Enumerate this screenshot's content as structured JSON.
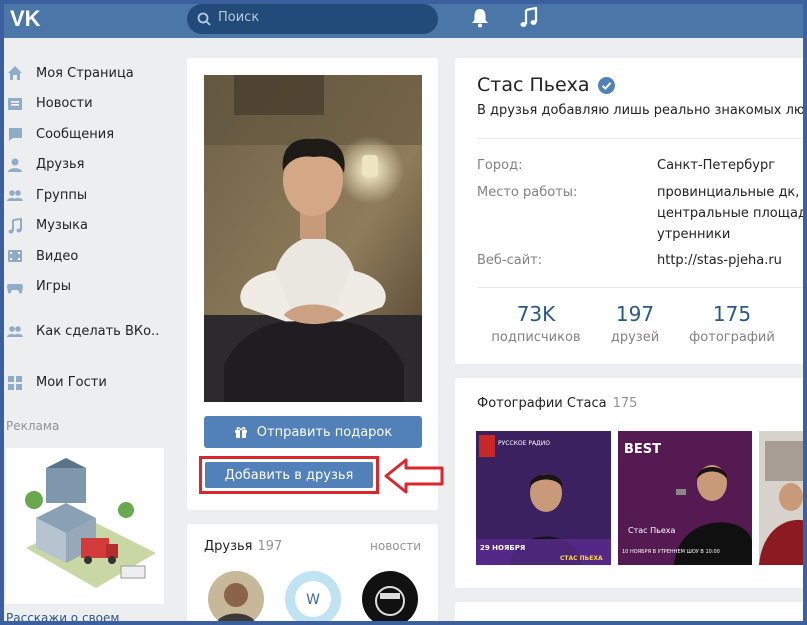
{
  "colors": {
    "header": "#4a76a8",
    "accent": "#5181b8",
    "link": "#2a5885",
    "annotation": "#d9262f"
  },
  "header": {
    "logo": "vk-logo",
    "search_placeholder": "Поиск",
    "icons": [
      "bell-icon",
      "music-icon"
    ]
  },
  "menu": {
    "items": [
      {
        "label": "Моя Страница",
        "icon": "home-icon"
      },
      {
        "label": "Новости",
        "icon": "news-icon"
      },
      {
        "label": "Сообщения",
        "icon": "messages-icon"
      },
      {
        "label": "Друзья",
        "icon": "friends-icon"
      },
      {
        "label": "Группы",
        "icon": "groups-icon"
      },
      {
        "label": "Музыка",
        "icon": "music-icon"
      },
      {
        "label": "Видео",
        "icon": "video-icon"
      },
      {
        "label": "Игры",
        "icon": "games-icon"
      }
    ],
    "extra": [
      {
        "label": "Как сделать ВКо..",
        "icon": "app-icon"
      },
      {
        "label": "Мои Гости",
        "icon": "app-icon"
      }
    ],
    "ad_label": "Реклама",
    "ad_text": "Расскажи о своем"
  },
  "avatar": {
    "gift_button": "Отправить подарок",
    "add_friend_button": "Добавить в друзья"
  },
  "friends": {
    "title": "Друзья",
    "count": "197",
    "news_link": "новости"
  },
  "profile": {
    "name": "Стас Пьеха",
    "status": "В друзья добавляю лишь реально знакомых люд",
    "info": [
      {
        "label": "Город:",
        "value": [
          "Санкт-Петербург"
        ]
      },
      {
        "label": "Место работы:",
        "value": [
          "провинциальные дк, м",
          "центральные площади",
          "утренники"
        ]
      },
      {
        "label": "Веб-сайт:",
        "value": [
          "http://stas-pjeha.ru"
        ]
      }
    ],
    "counters": [
      {
        "num": "73K",
        "label": "подписчиков"
      },
      {
        "num": "197",
        "label": "друзей"
      },
      {
        "num": "175",
        "label": "фотографий"
      }
    ]
  },
  "photos": {
    "title": "Фотографии Стаса",
    "count": "175",
    "poster1": {
      "radio": "РУССКОЕ РАДИО",
      "date": "29 НОЯБРЯ",
      "name": "СТАС ПЬЕХА"
    },
    "poster2": {
      "brand": "BEST",
      "name": "Стас Пьеха",
      "date": "10 НОЯБРЯ В УТРЕННЕМ ШОУ В 10:00"
    }
  }
}
